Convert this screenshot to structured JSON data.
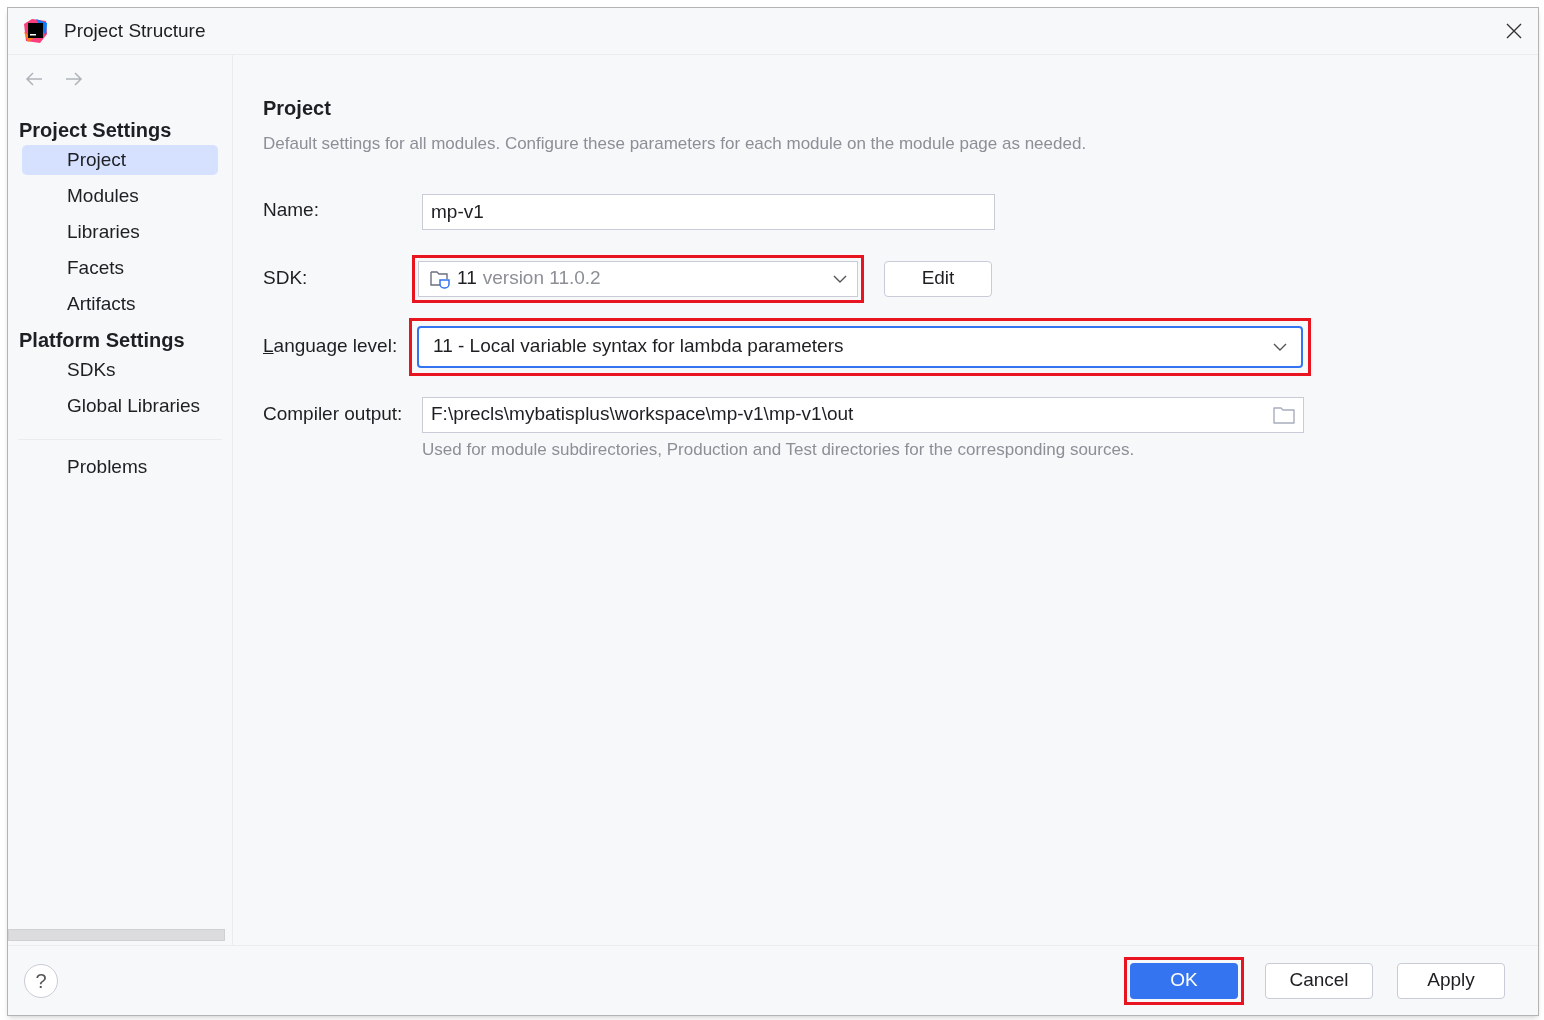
{
  "window": {
    "title": "Project Structure"
  },
  "sidebar": {
    "sections": [
      {
        "title": "Project Settings",
        "items": [
          {
            "label": "Project",
            "selected": true
          },
          {
            "label": "Modules",
            "selected": false
          },
          {
            "label": "Libraries",
            "selected": false
          },
          {
            "label": "Facets",
            "selected": false
          },
          {
            "label": "Artifacts",
            "selected": false
          }
        ]
      },
      {
        "title": "Platform Settings",
        "items": [
          {
            "label": "SDKs",
            "selected": false
          },
          {
            "label": "Global Libraries",
            "selected": false
          }
        ]
      }
    ],
    "extra_items": [
      {
        "label": "Problems",
        "selected": false
      }
    ]
  },
  "content": {
    "title": "Project",
    "description": "Default settings for all modules. Configure these parameters for each module on the module page as needed.",
    "fields": [
      {
        "kind": "text",
        "label": "Name:",
        "value": "mp-v1"
      },
      {
        "kind": "sdk",
        "label": "SDK:",
        "value": "11",
        "detail": "version 11.0.2",
        "button": "Edit",
        "highlighted": true
      },
      {
        "kind": "select",
        "label": "Language level:",
        "mnemonic": true,
        "value": "11 - Local variable syntax for lambda parameters",
        "highlighted": true,
        "focused": true
      },
      {
        "kind": "path",
        "label": "Compiler output:",
        "value": "F:\\precls\\mybatisplus\\workspace\\mp-v1\\mp-v1\\out",
        "hint": "Used for module subdirectories, Production and Test directories for the corresponding sources."
      }
    ]
  },
  "footer": {
    "help": "?",
    "buttons": [
      {
        "label": "OK",
        "primary": true,
        "highlighted": true
      },
      {
        "label": "Cancel",
        "primary": false,
        "highlighted": false
      },
      {
        "label": "Apply",
        "primary": false,
        "highlighted": false
      }
    ]
  }
}
